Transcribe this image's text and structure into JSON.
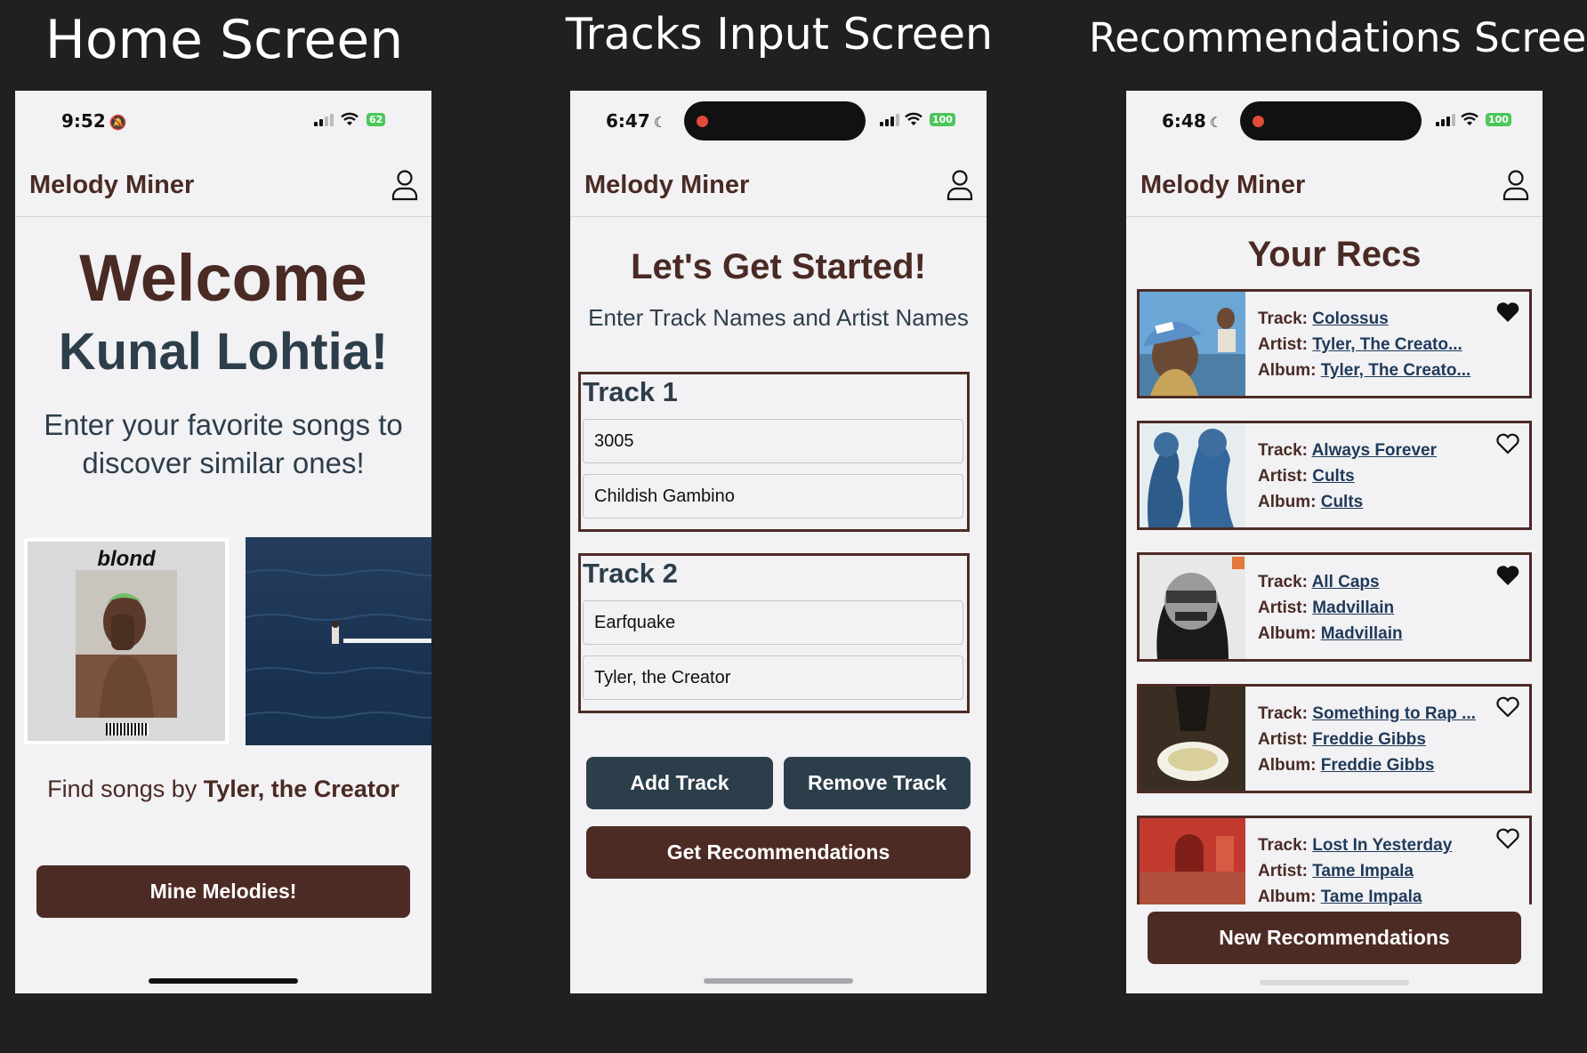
{
  "captions": {
    "home": "Home Screen",
    "tracks": "Tracks Input Screen",
    "recs": "Recommendations Screen"
  },
  "app_name": "Melody Miner",
  "home": {
    "time": "9:52",
    "battery": "62",
    "welcome": "Welcome",
    "user_name": "Kunal Lohtia!",
    "subtitle": "Enter your favorite songs to discover similar ones!",
    "album1_title": "blond",
    "find_prefix": "Find songs by ",
    "find_artist": "Tyler, the Creator",
    "cta": "Mine Melodies!"
  },
  "tracks_screen": {
    "time": "6:47",
    "battery": "100",
    "title": "Let's Get Started!",
    "subtitle": "Enter Track Names and Artist Names",
    "tracks": [
      {
        "label": "Track 1",
        "track": "3005",
        "artist": "Childish Gambino"
      },
      {
        "label": "Track 2",
        "track": "Earfquake",
        "artist": "Tyler, the Creator"
      }
    ],
    "add": "Add Track",
    "remove": "Remove Track",
    "get": "Get Recommendations"
  },
  "recs_screen": {
    "time": "6:48",
    "battery": "100",
    "title": "Your Recs",
    "labels": {
      "track": "Track: ",
      "artist": "Artist: ",
      "album": "Album: "
    },
    "items": [
      {
        "track": "Colossus",
        "artist": "Tyler, The Creato...",
        "album": "Tyler, The Creato...",
        "liked": true
      },
      {
        "track": "Always Forever",
        "artist": "Cults",
        "album": "Cults",
        "liked": false
      },
      {
        "track": "All Caps",
        "artist": "Madvillain",
        "album": "Madvillain",
        "liked": true
      },
      {
        "track": "Something to Rap ...",
        "artist": "Freddie Gibbs",
        "album": "Freddie Gibbs",
        "liked": false
      },
      {
        "track": "Lost In Yesterday",
        "artist": "Tame Impala",
        "album": "Tame Impala",
        "liked": false
      }
    ],
    "new": "New Recommendations"
  },
  "colors": {
    "brown": "#4d2b25",
    "slate": "#2d3e4b",
    "link": "#1f3a5a",
    "battery": "#4cc75b"
  }
}
